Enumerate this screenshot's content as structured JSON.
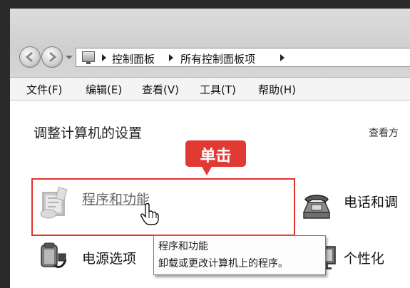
{
  "address": {
    "crumbs": [
      "控制面板",
      "所有控制面板项"
    ]
  },
  "menu": [
    "文件(F)",
    "编辑(E)",
    "查看(V)",
    "工具(T)",
    "帮助(H)"
  ],
  "main": {
    "heading": "调整计算机的设置",
    "view_by": "查看方"
  },
  "callout": {
    "label": "单击"
  },
  "items": {
    "programs": "程序和功能",
    "phone": "电话和调",
    "power": "电源选项",
    "personalize": "个性化"
  },
  "tooltip": {
    "title": "程序和功能",
    "desc": "卸载或更改计算机上的程序。"
  }
}
